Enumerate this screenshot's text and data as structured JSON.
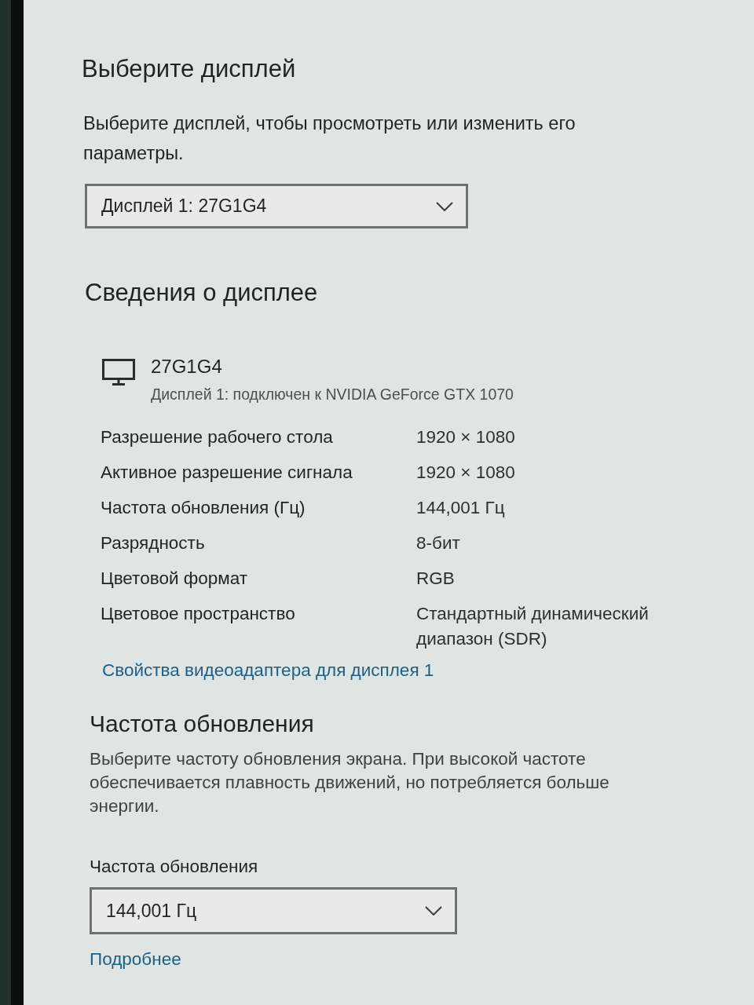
{
  "select_display": {
    "title": "Выберите дисплей",
    "description": "Выберите дисплей, чтобы просмотреть или изменить его параметры.",
    "dropdown": {
      "value": "Дисплей 1: 27G1G4"
    }
  },
  "display_info": {
    "title": "Сведения о дисплее",
    "monitor": {
      "name": "27G1G4",
      "subtitle": "Дисплей 1: подключен к NVIDIA GeForce GTX 1070"
    },
    "rows": [
      {
        "label": "Разрешение рабочего стола",
        "value": "1920 × 1080"
      },
      {
        "label": "Активное разрешение сигнала",
        "value": "1920 × 1080"
      },
      {
        "label": "Частота обновления (Гц)",
        "value": "144,001 Гц"
      },
      {
        "label": "Разрядность",
        "value": "8-бит"
      },
      {
        "label": "Цветовой формат",
        "value": "RGB"
      },
      {
        "label": "Цветовое пространство",
        "value": "Стандартный динамический диапазон (SDR)"
      }
    ],
    "link": "Свойства видеоадаптера для дисплея 1"
  },
  "refresh_rate": {
    "title": "Частота обновления",
    "description": "Выберите частоту обновления экрана. При высокой частоте обеспечивается плавность движений, но потребляется больше энергии.",
    "field_label": "Частота обновления",
    "dropdown": {
      "value": "144,001 Гц"
    },
    "link": "Подробнее"
  }
}
